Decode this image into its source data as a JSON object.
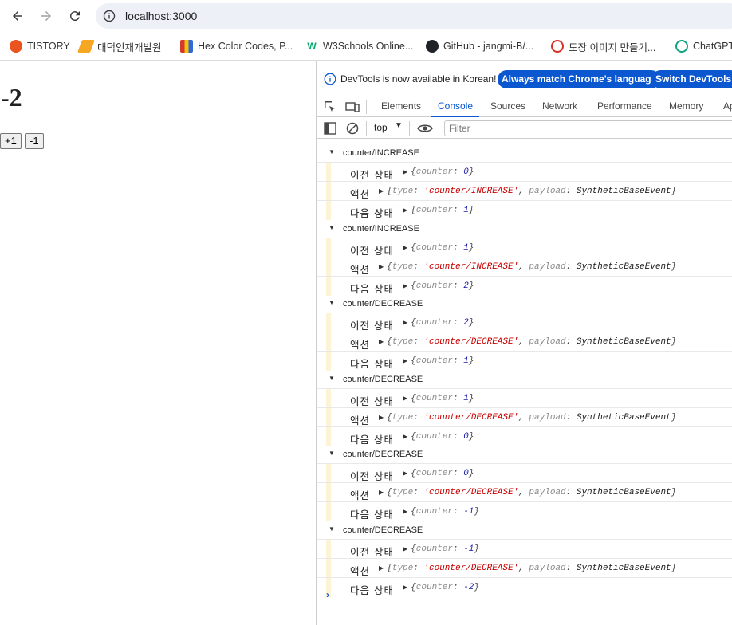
{
  "browser": {
    "url": "localhost:3000",
    "bookmarks": [
      {
        "label": "TISTORY",
        "icon": "tistory-icon",
        "color": "#eb531f"
      },
      {
        "label": "대덕인재개발원",
        "icon": "ddit-icon",
        "color": "#f5a623"
      },
      {
        "label": "Hex Color Codes, P...",
        "icon": "hex-color-icon",
        "color": "#d33a2c"
      },
      {
        "label": "W3Schools Online...",
        "icon": "w3schools-icon",
        "color": "#04aa6d"
      },
      {
        "label": "GitHub - jangmi-B/...",
        "icon": "github-icon",
        "color": "#1f2328"
      },
      {
        "label": "도장 이미지 만들기...",
        "icon": "stamp-icon",
        "color": "#d93025"
      },
      {
        "label": "ChatGPT",
        "icon": "chatgpt-icon",
        "color": "#10a37f"
      }
    ]
  },
  "page": {
    "counter_value": "-2",
    "increment_label": "+1",
    "decrement_label": "-1"
  },
  "devtools": {
    "info_message": "DevTools is now available in Korean!",
    "match_language_button": "Always match Chrome's language",
    "switch_button": "Switch DevTools to Korean",
    "tabs": [
      "Elements",
      "Console",
      "Sources",
      "Network",
      "Performance",
      "Memory",
      "Application"
    ],
    "active_tab": "Console",
    "context": "top",
    "filter_placeholder": "Filter",
    "prompt": "›",
    "log_groups": [
      {
        "action": "counter/INCREASE",
        "prev": "0",
        "type": "counter/INCREASE",
        "next": "1"
      },
      {
        "action": "counter/INCREASE",
        "prev": "1",
        "type": "counter/INCREASE",
        "next": "2"
      },
      {
        "action": "counter/DECREASE",
        "prev": "2",
        "type": "counter/DECREASE",
        "next": "1"
      },
      {
        "action": "counter/DECREASE",
        "prev": "1",
        "type": "counter/DECREASE",
        "next": "0"
      },
      {
        "action": "counter/DECREASE",
        "prev": "0",
        "type": "counter/DECREASE",
        "next": "-1"
      },
      {
        "action": "counter/DECREASE",
        "prev": "-1",
        "type": "counter/DECREASE",
        "next": "-2"
      }
    ],
    "labels": {
      "prev_state": "이전 상태",
      "action": "액션",
      "next_state": "다음 상태",
      "counter_key": "counter",
      "type_key": "type",
      "payload_key": "payload",
      "payload_value": "SyntheticBaseEvent"
    }
  }
}
